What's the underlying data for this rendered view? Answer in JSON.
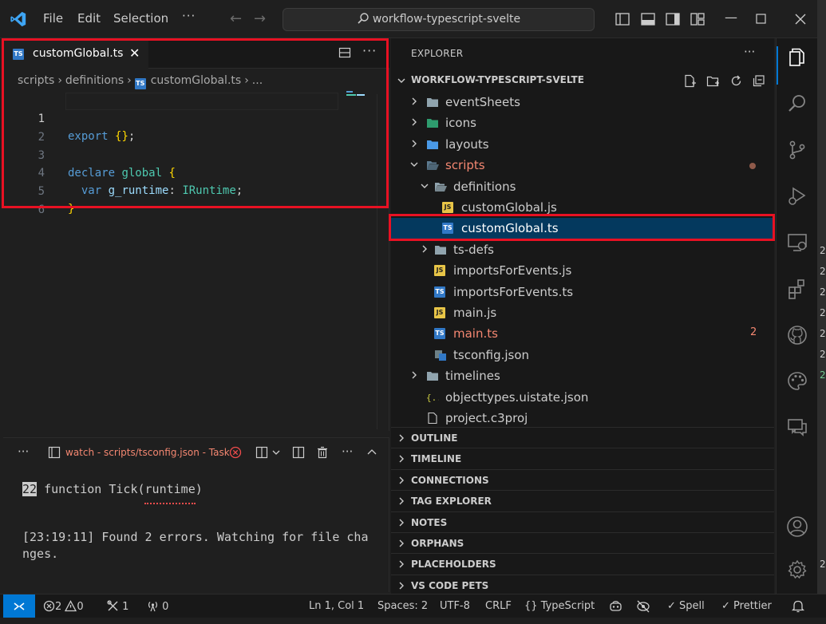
{
  "window": {
    "menu": [
      "File",
      "Edit",
      "Selection"
    ],
    "search_text": "workflow-typescript-svelte"
  },
  "editor": {
    "tab_label": "customGlobal.ts",
    "breadcrumb": [
      "scripts",
      "definitions",
      "customGlobal.ts",
      "..."
    ],
    "line_numbers": [
      "1",
      "2",
      "3",
      "4",
      "5",
      "6"
    ],
    "code": {
      "l1_kw": "export",
      "l1_br": "{}",
      "l1_end": ";",
      "l3_kw": "declare",
      "l3_id": "global",
      "l3_br": "{",
      "l4_kw": "var",
      "l4_var": "g_runtime",
      "l4_colon": ":",
      "l4_type": "IRuntime",
      "l4_end": ";",
      "l5_br": "}"
    }
  },
  "panel": {
    "task_label": "watch - scripts/tsconfig.json - Task",
    "term_line_num": "22",
    "term_line_code": " function Tick(runtime)",
    "term_msg_1": "[23:19:11] Found 2 errors. Watching for file cha",
    "term_msg_2": "nges."
  },
  "explorer": {
    "title": "EXPLORER",
    "workspace": "WORKFLOW-TYPESCRIPT-SVELTE",
    "tree": [
      {
        "label": "eventSheets",
        "kind": "folder"
      },
      {
        "label": "icons",
        "kind": "folder"
      },
      {
        "label": "layouts",
        "kind": "folder"
      },
      {
        "label": "scripts",
        "kind": "folder-open"
      },
      {
        "label": "definitions",
        "kind": "folder-open"
      },
      {
        "label": "customGlobal.js",
        "kind": "js"
      },
      {
        "label": "customGlobal.ts",
        "kind": "ts"
      },
      {
        "label": "ts-defs",
        "kind": "folder"
      },
      {
        "label": "importsForEvents.js",
        "kind": "js"
      },
      {
        "label": "importsForEvents.ts",
        "kind": "ts"
      },
      {
        "label": "main.js",
        "kind": "js"
      },
      {
        "label": "main.ts",
        "kind": "ts"
      },
      {
        "label": "tsconfig.json",
        "kind": "tsconfig"
      },
      {
        "label": "timelines",
        "kind": "folder"
      },
      {
        "label": "objecttypes.uistate.json",
        "kind": "json"
      },
      {
        "label": "project.c3proj",
        "kind": "file"
      }
    ],
    "main_ts_errors": "2",
    "sections": [
      "OUTLINE",
      "TIMELINE",
      "CONNECTIONS",
      "TAG EXPLORER",
      "NOTES",
      "ORPHANS",
      "PLACEHOLDERS",
      "VS CODE PETS"
    ]
  },
  "statusbar": {
    "errors": "2",
    "warnings": "0",
    "ports": "1",
    "radio": "0",
    "position": "Ln 1, Col 1",
    "spaces": "Spaces: 2",
    "encoding": "UTF-8",
    "eol": "CRLF",
    "language_braces": "{}",
    "language": "TypeScript",
    "spell": "Spell",
    "prettier": "Prettier"
  },
  "right_edge_digits": [
    "2",
    "2",
    "2",
    "2",
    "2",
    "2",
    "2",
    "2"
  ],
  "colors": {
    "accent": "#0078d4",
    "error_text": "#f48771",
    "selection": "#04395e",
    "highlight_box": "#e81123",
    "ts_badge": "#3178c6",
    "js_badge": "#e8c547"
  }
}
